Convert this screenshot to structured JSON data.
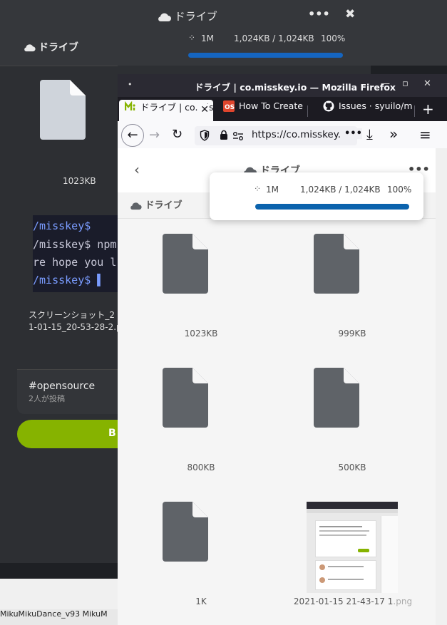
{
  "background": {
    "drive_title": "ドライブ",
    "file_size": "1023KB",
    "terminal_lines": [
      "/misskey$",
      "/misskey$ npm",
      "re hope you l",
      "/misskey$ ▌"
    ],
    "caption_line1": "スクリーンショット_2",
    "caption_line2": "1-01-15_20-53-28-2.p",
    "tag": "#opensource",
    "tag_sub": "2人が投稿",
    "green_label": "B",
    "taskbar_text": "MikuMikuDance_v93   MikuM",
    "notification": {
      "title": "ドライブ",
      "more": "•••",
      "close": "✖",
      "spinner": "⁘",
      "name": "1M",
      "bytes": "1,024KB / 1,024KB",
      "percent": "100%"
    }
  },
  "firefox": {
    "window_title": "ドライブ | co.misskey.io — Mozilla Firefox",
    "title_dot": "•",
    "window_buttons": [
      "—",
      "▫",
      "✕"
    ],
    "tabs": [
      {
        "label": "ドライブ | co.misskey.io",
        "active": true
      },
      {
        "label": "How To Create",
        "active": false
      },
      {
        "label": "Issues · syuilo/misskey",
        "active": false
      }
    ],
    "tab_close": "✕",
    "new_tab": "+",
    "nav": {
      "back": "←",
      "forward": "→",
      "reload": "↻",
      "url": "https://co.misskey.io",
      "page_actions": "•••",
      "download": "⤓",
      "overflow": "»",
      "menu": "≡"
    }
  },
  "page": {
    "back": "‹",
    "title": "ドライブ",
    "more": "•••",
    "subheader": "ドライブ",
    "upload": {
      "spinner": "⁘",
      "name": "1M",
      "bytes": "1,024KB / 1,024KB",
      "percent": "100%",
      "progress": 1.0
    },
    "files": [
      {
        "label": "1023KB",
        "type": "file"
      },
      {
        "label": "999KB",
        "type": "file"
      },
      {
        "label": "800KB",
        "type": "file"
      },
      {
        "label": "500KB",
        "type": "file"
      },
      {
        "label": "1K",
        "type": "file"
      },
      {
        "label": "2021-01-15 21-43-17 1",
        "ext": ".png",
        "type": "image"
      }
    ]
  },
  "colors": {
    "accent_green": "#86b300",
    "progress_blue": "#0b63ad",
    "file_icon": "#5f6368"
  }
}
